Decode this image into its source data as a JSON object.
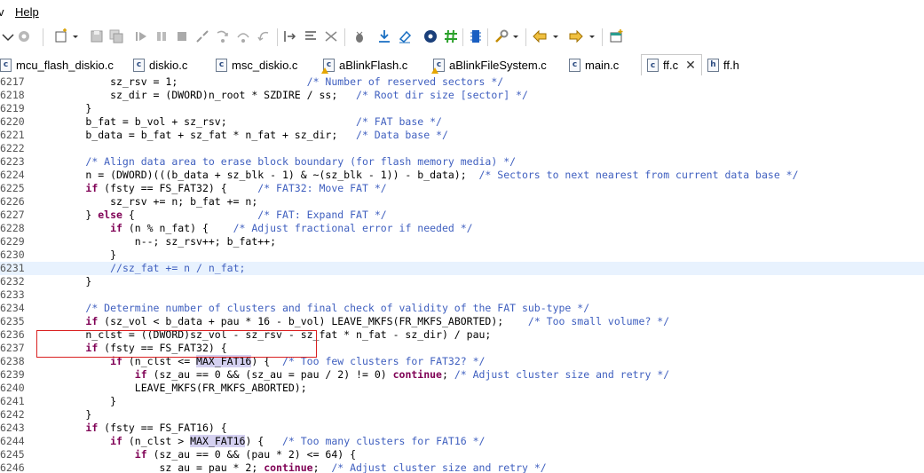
{
  "menubar": {
    "items": [
      "v",
      "Help"
    ]
  },
  "toolbar": {
    "icons": [
      "dropdown-check-icon",
      "gear-icon",
      "new-file-icon",
      "save-icon",
      "save-all-icon",
      "run-icon",
      "pause-icon",
      "stop-icon",
      "step-into-icon",
      "step-over-icon",
      "step-return-icon",
      "step-out-icon",
      "indent-icon",
      "format-icon",
      "cleanup-icon",
      "debug-icon",
      "download-icon",
      "erase-icon",
      "settings-gear-icon",
      "hash-icon",
      "chip-icon",
      "tools-icon",
      "back-icon",
      "forward-icon",
      "open-perspective-icon"
    ]
  },
  "tabs": [
    {
      "label": "mcu_flash_diskio.c",
      "active": false,
      "warn": false
    },
    {
      "label": "diskio.c",
      "active": false,
      "warn": false
    },
    {
      "label": "msc_diskio.c",
      "active": false,
      "warn": false
    },
    {
      "label": "aBlinkFlash.c",
      "active": false,
      "warn": true
    },
    {
      "label": "aBlinkFileSystem.c",
      "active": false,
      "warn": true
    },
    {
      "label": "main.c",
      "active": false,
      "warn": false
    },
    {
      "label": "ff.c",
      "active": true,
      "warn": false
    },
    {
      "label": "ff.h",
      "active": false,
      "warn": false,
      "type": "h"
    }
  ],
  "code": {
    "lines": [
      {
        "n": "6217",
        "t": "            sz_rsv = 1;                     /* Number of reserved sectors */"
      },
      {
        "n": "6218",
        "t": "            sz_dir = (DWORD)n_root * SZDIRE / ss;   /* Root dir size [sector] */"
      },
      {
        "n": "6219",
        "t": "        }"
      },
      {
        "n": "6220",
        "t": "        b_fat = b_vol + sz_rsv;                     /* FAT base */"
      },
      {
        "n": "6221",
        "t": "        b_data = b_fat + sz_fat * n_fat + sz_dir;   /* Data base */"
      },
      {
        "n": "6222",
        "t": ""
      },
      {
        "n": "6223",
        "t": "        /* Align data area to erase block boundary (for flash memory media) */"
      },
      {
        "n": "6224",
        "t": "        n = (DWORD)(((b_data + sz_blk - 1) & ~(sz_blk - 1)) - b_data);  /* Sectors to next nearest from current data base */"
      },
      {
        "n": "6225",
        "t": "        if (fsty == FS_FAT32) {     /* FAT32: Move FAT */"
      },
      {
        "n": "6226",
        "t": "            sz_rsv += n; b_fat += n;"
      },
      {
        "n": "6227",
        "t": "        } else {                    /* FAT: Expand FAT */"
      },
      {
        "n": "6228",
        "t": "            if (n % n_fat) {    /* Adjust fractional error if needed */"
      },
      {
        "n": "6229",
        "t": "                n--; sz_rsv++; b_fat++;"
      },
      {
        "n": "6230",
        "t": "            }"
      },
      {
        "n": "6231",
        "t": "            //sz_fat += n / n_fat;"
      },
      {
        "n": "6232",
        "t": "        }"
      },
      {
        "n": "6233",
        "t": ""
      },
      {
        "n": "6234",
        "t": "        /* Determine number of clusters and final check of validity of the FAT sub-type */"
      },
      {
        "n": "6235",
        "t": "        if (sz_vol < b_data + pau * 16 - b_vol) LEAVE_MKFS(FR_MKFS_ABORTED);    /* Too small volume? */"
      },
      {
        "n": "6236",
        "t": "        n_clst = ((DWORD)sz_vol - sz_rsv - sz_fat * n_fat - sz_dir) / pau;"
      },
      {
        "n": "6237",
        "t": "        if (fsty == FS_FAT32) {"
      },
      {
        "n": "6238",
        "t": "            if (n_clst <= MAX_FAT16) {  /* Too few clusters for FAT32? */"
      },
      {
        "n": "6239",
        "t": "                if (sz_au == 0 && (sz_au = pau / 2) != 0) continue; /* Adjust cluster size and retry */"
      },
      {
        "n": "6240",
        "t": "                LEAVE_MKFS(FR_MKFS_ABORTED);"
      },
      {
        "n": "6241",
        "t": "            }"
      },
      {
        "n": "6242",
        "t": "        }"
      },
      {
        "n": "6243",
        "t": "        if (fsty == FS_FAT16) {"
      },
      {
        "n": "6244",
        "t": "            if (n_clst > MAX_FAT16) {   /* Too many clusters for FAT16 */"
      },
      {
        "n": "6245",
        "t": "                if (sz_au == 0 && (pau * 2) <= 64) {"
      },
      {
        "n": "6246",
        "t": "                    sz_au = pau * 2; continue;  /* Adjust cluster size and retry */"
      }
    ],
    "current_line": "6231",
    "highlight_word": "MAX_FAT16",
    "keywords": [
      "if",
      "else",
      "continue"
    ]
  },
  "colors": {
    "comment": "#3f5fbf",
    "keyword": "#7f0055",
    "current_line_bg": "#e8f2fe",
    "annotation_box": "#d92020",
    "highlight_bg": "#d4d0f0"
  }
}
